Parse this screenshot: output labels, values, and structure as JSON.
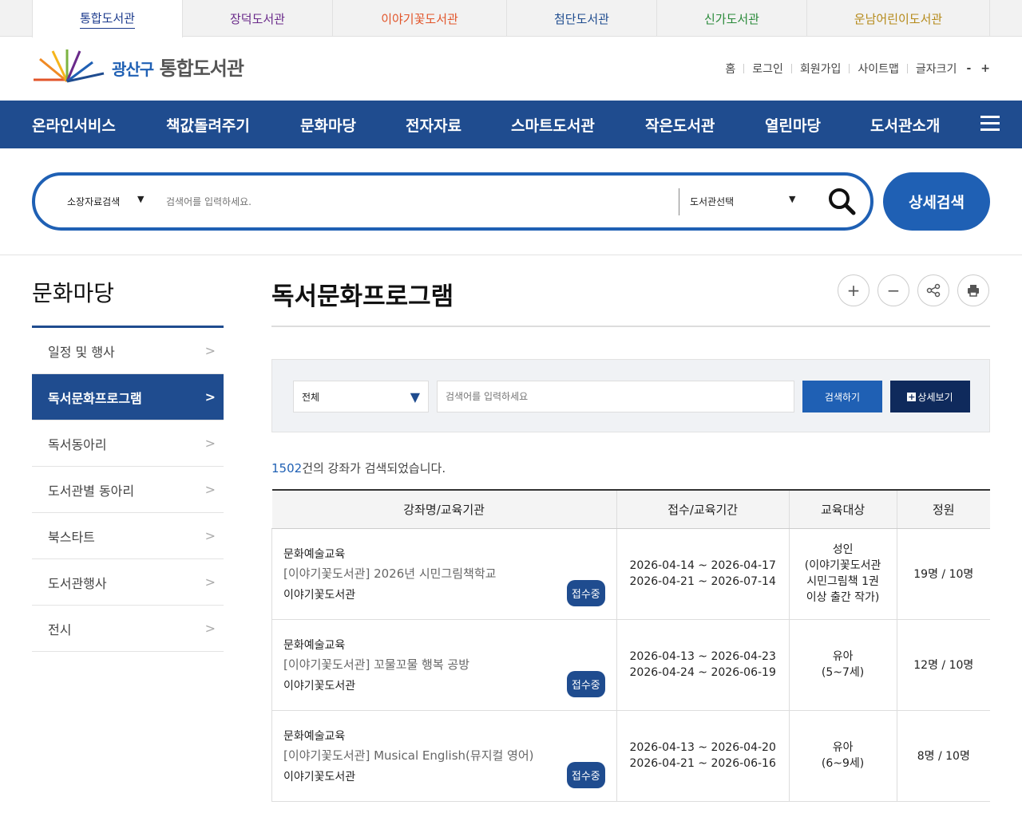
{
  "library_tabs": [
    {
      "label": "통합도서관",
      "color": "#1b3a8c"
    },
    {
      "label": "장덕도서관",
      "color": "#6a2a8a"
    },
    {
      "label": "이야기꽃도서관",
      "color": "#e2552a"
    },
    {
      "label": "첨단도서관",
      "color": "#1f4c8f"
    },
    {
      "label": "신가도서관",
      "color": "#2a8a3a"
    },
    {
      "label": "운남어린이도서관",
      "color": "#b58a1a"
    }
  ],
  "logo": {
    "prefix": "광산구",
    "name": "통합도서관"
  },
  "util_links": [
    "홈",
    "로그인",
    "회원가입",
    "사이트맵"
  ],
  "font_size": {
    "label": "글자크기",
    "minus": "-",
    "plus": "+"
  },
  "gnb": [
    "온라인서비스",
    "책값돌려주기",
    "문화마당",
    "전자자료",
    "스마트도서관",
    "작은도서관",
    "열린마당",
    "도서관소개"
  ],
  "search": {
    "type_select": "소장자료검색",
    "placeholder": "검색어를 입력하세요.",
    "library_select": "도서관선택",
    "detail_button": "상세검색"
  },
  "lnb": {
    "title": "문화마당",
    "items": [
      "일정 및 행사",
      "독서문화프로그램",
      "독서동아리",
      "도서관별 동아리",
      "북스타트",
      "도서관행사",
      "전시"
    ],
    "active_index": 1
  },
  "page": {
    "title": "독서문화프로그램"
  },
  "filter": {
    "select": "전체",
    "placeholder": "검색어를 입력하세요",
    "search_button": "검색하기",
    "detail_button": "상세보기"
  },
  "result": {
    "count": "1502",
    "suffix": "건의 강좌가 검색되었습니다."
  },
  "table": {
    "headers": [
      "강좌명/교육기관",
      "접수/교육기간",
      "교육대상",
      "정원"
    ],
    "rows": [
      {
        "category": "문화예술교육",
        "title": "[이야기꽃도서관] 2026년 시민그림책학교",
        "org": "이야기꽃도서관",
        "badge": "접수중",
        "apply": "2026-04-14 ~ 2026-04-17",
        "edu": "2026-04-21 ~ 2026-07-14",
        "target": [
          "성인",
          "(이야기꽃도서관",
          "시민그림책 1권",
          "이상 출간 작가)"
        ],
        "capacity": "19명 / 10명"
      },
      {
        "category": "문화예술교육",
        "title": "[이야기꽃도서관] 꼬물꼬물 행복 공방",
        "org": "이야기꽃도서관",
        "badge": "접수중",
        "apply": "2026-04-13 ~ 2026-04-23",
        "edu": "2026-04-24 ~ 2026-06-19",
        "target": [
          "유아",
          "(5~7세)"
        ],
        "capacity": "12명 / 10명"
      },
      {
        "category": "문화예술교육",
        "title": "[이야기꽃도서관] Musical English(뮤지컬 영어)",
        "org": "이야기꽃도서관",
        "badge": "접수중",
        "apply": "2026-04-13 ~ 2026-04-20",
        "edu": "2026-04-21 ~ 2026-06-16",
        "target": [
          "유아",
          "(6~9세)"
        ],
        "capacity": "8명 / 10명"
      }
    ]
  }
}
